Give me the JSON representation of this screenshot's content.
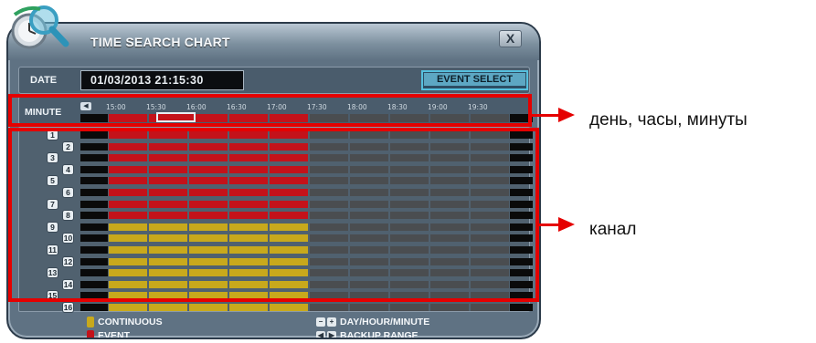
{
  "window": {
    "title": "TIME SEARCH CHART",
    "close_label": "X"
  },
  "date": {
    "label": "DATE",
    "value": "01/03/2013 21:15:30",
    "event_select_label": "EVENT SELECT"
  },
  "minute": {
    "label": "MINUTE",
    "ticks": [
      "15:00",
      "15:30",
      "16:00",
      "16:30",
      "17:00",
      "17:30",
      "18:00",
      "18:30",
      "19:00",
      "19:30"
    ]
  },
  "channels": {
    "labels": [
      "1",
      "2",
      "3",
      "4",
      "5",
      "6",
      "7",
      "8",
      "9",
      "10",
      "11",
      "12",
      "13",
      "14",
      "15",
      "16"
    ],
    "recorded_segments": 5,
    "total_segments": 10,
    "event_channels": 8,
    "continuous_channels": 8
  },
  "legend": {
    "continuous": "CONTINUOUS",
    "event": "EVENT",
    "day_hour_minute": "DAY/HOUR/MINUTE",
    "backup_range": "BACKUP RANGE"
  },
  "colors": {
    "event": "#c4121a",
    "continuous": "#c8a91c",
    "empty": "#4a4d50",
    "annotation": "#e50000"
  },
  "annotations": {
    "time_note": "день, часы, минуты",
    "channel_note": "канал"
  }
}
